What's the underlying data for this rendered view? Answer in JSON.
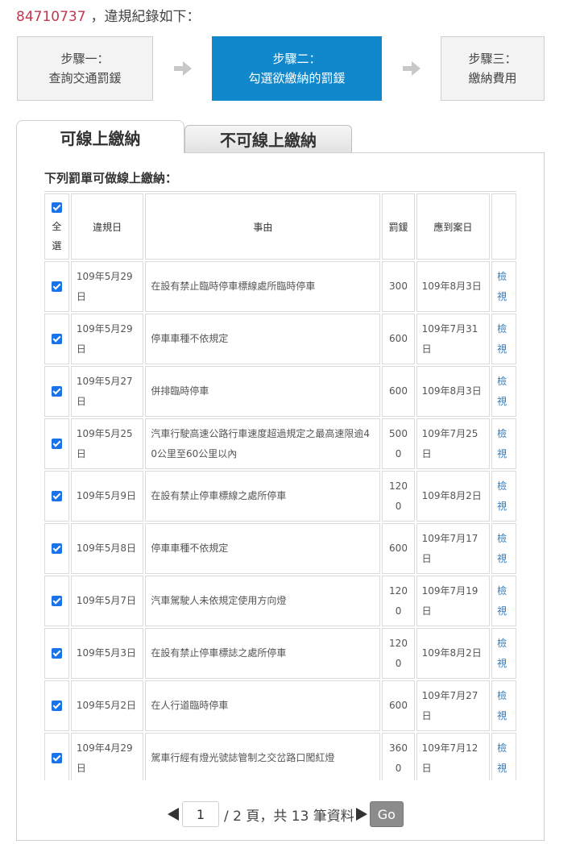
{
  "header": {
    "plate": "84710737",
    "text": "，違規紀錄如下："
  },
  "steps": [
    {
      "line1": "步驟一：",
      "line2": "查詢交通罰鍰"
    },
    {
      "line1": "步驟二：",
      "line2": "勾選欲繳納的罰鍰"
    },
    {
      "line1": "步驟三：",
      "line2": "繳納費用"
    }
  ],
  "tabs": {
    "online": "可線上繳納",
    "offline": "不可線上繳納"
  },
  "panel": {
    "title": "下列罰單可做線上繳納："
  },
  "table": {
    "headers": {
      "select_all_1": "全",
      "select_all_2": "選",
      "date": "違規日",
      "reason": "事由",
      "fine": "罰鍰",
      "due": "應到案日"
    },
    "rows": [
      {
        "date": "109年5月29日",
        "reason": "在設有禁止臨時停車標線處所臨時停車",
        "fine": "300",
        "due": "109年8月3日",
        "view": "檢視"
      },
      {
        "date": "109年5月29日",
        "reason": "停車車種不依規定",
        "fine": "600",
        "due": "109年7月31日",
        "view": "檢視"
      },
      {
        "date": "109年5月27日",
        "reason": "併排臨時停車",
        "fine": "600",
        "due": "109年8月3日",
        "view": "檢視"
      },
      {
        "date": "109年5月25日",
        "reason": "汽車行駛高速公路行車速度超過規定之最高速限逾40公里至60公里以內",
        "fine": "5000",
        "due": "109年7月25日",
        "view": "檢視"
      },
      {
        "date": "109年5月9日",
        "reason": "在設有禁止停車標線之處所停車",
        "fine": "1200",
        "due": "109年8月2日",
        "view": "檢視"
      },
      {
        "date": "109年5月8日",
        "reason": "停車車種不依規定",
        "fine": "600",
        "due": "109年7月17日",
        "view": "檢視"
      },
      {
        "date": "109年5月7日",
        "reason": "汽車駕駛人未依規定使用方向燈",
        "fine": "1200",
        "due": "109年7月19日",
        "view": "檢視"
      },
      {
        "date": "109年5月3日",
        "reason": "在設有禁止停車標誌之處所停車",
        "fine": "1200",
        "due": "109年8月2日",
        "view": "檢視"
      },
      {
        "date": "109年5月2日",
        "reason": "在人行道臨時停車",
        "fine": "600",
        "due": "109年7月27日",
        "view": "檢視"
      },
      {
        "date": "109年4月29日",
        "reason": "駕車行經有燈光號誌管制之交岔路口闖紅燈",
        "fine": "3600",
        "due": "109年7月12日",
        "view": "檢視"
      }
    ]
  },
  "pager": {
    "page_value": "1",
    "text": "/ 2 頁，共 13 筆資料",
    "go_label": "Go"
  },
  "colors": {
    "accent": "#1188cc",
    "plate": "#c0394e",
    "link": "#2f7ec0"
  }
}
